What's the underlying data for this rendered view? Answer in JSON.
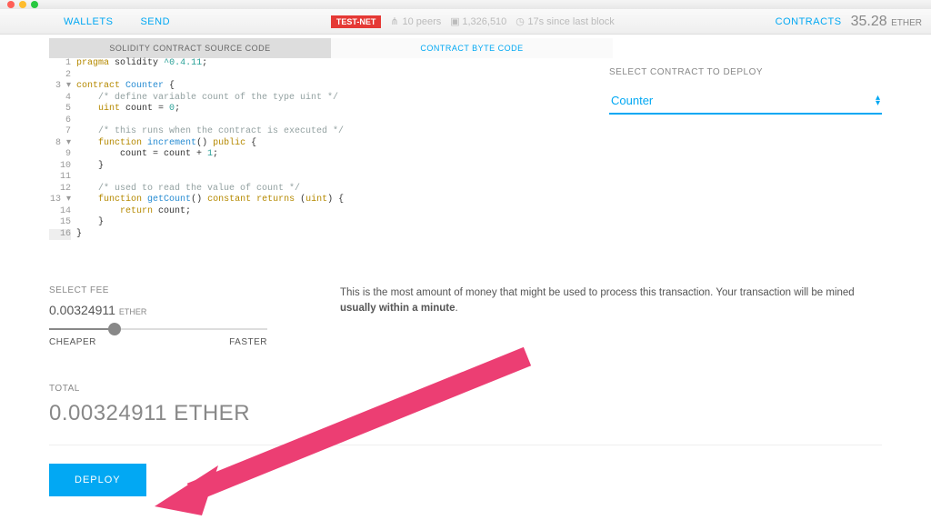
{
  "nav": {
    "wallets": "WALLETS",
    "send": "SEND",
    "testnet_badge": "TEST-NET",
    "peers": "10 peers",
    "block_height": "1,326,510",
    "since_last": "17s since last block",
    "contracts": "CONTRACTS",
    "balance_value": "35.28",
    "balance_unit": "ETHER"
  },
  "tabs": {
    "source": "SOLIDITY CONTRACT SOURCE CODE",
    "bytecode": "CONTRACT BYTE CODE"
  },
  "code": {
    "lines": [
      {
        "n": "1"
      },
      {
        "n": "2"
      },
      {
        "n": "3",
        "fold": true
      },
      {
        "n": "4"
      },
      {
        "n": "5"
      },
      {
        "n": "6"
      },
      {
        "n": "7"
      },
      {
        "n": "8",
        "fold": true
      },
      {
        "n": "9"
      },
      {
        "n": "10"
      },
      {
        "n": "11"
      },
      {
        "n": "12"
      },
      {
        "n": "13",
        "fold": true
      },
      {
        "n": "14"
      },
      {
        "n": "15"
      },
      {
        "n": "16"
      }
    ],
    "pragma_kw": "pragma",
    "pragma_ident": "solidity",
    "pragma_ver": "^0.4.11",
    "contract_kw": "contract",
    "contract_name": "Counter",
    "comment1": "/* define variable count of the type uint */",
    "uint_kw": "uint",
    "var_count": "count",
    "zero": "0",
    "comment2": "/* this runs when the contract is executed */",
    "function_kw": "function",
    "fn_inc": "increment",
    "public_kw": "public",
    "one": "1",
    "comment3": "/* used to read the value of count */",
    "fn_get": "getCount",
    "constant_kw": "constant",
    "returns_kw": "returns",
    "return_kw": "return"
  },
  "deploy_select": {
    "label": "SELECT CONTRACT TO DEPLOY",
    "value": "Counter"
  },
  "fee": {
    "label": "SELECT FEE",
    "amount": "0.00324911",
    "unit": "ETHER",
    "cheaper": "CHEAPER",
    "faster": "FASTER",
    "slider_percent": 30,
    "desc_prefix": "This is the most amount of money that might be used to process this transaction. Your transaction will be mined ",
    "desc_bold": "usually within a minute",
    "desc_suffix": "."
  },
  "total": {
    "label": "TOTAL",
    "amount": "0.00324911 ETHER"
  },
  "deploy_button": "DEPLOY"
}
